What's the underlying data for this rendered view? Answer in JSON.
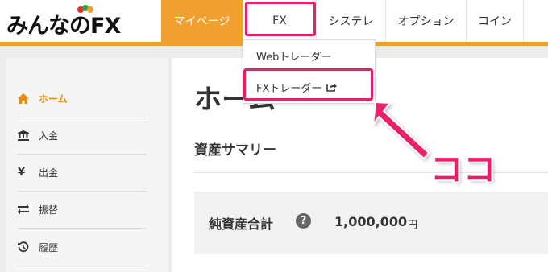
{
  "logo": {
    "text": "みんなのFX"
  },
  "nav": {
    "tabs": [
      {
        "label": "マイページ",
        "active": true
      },
      {
        "label": "FX",
        "active": false
      },
      {
        "label": "システレ",
        "active": false
      },
      {
        "label": "オプション",
        "active": false
      },
      {
        "label": "コイン",
        "active": false
      }
    ]
  },
  "dropdown": {
    "items": [
      {
        "label": "Webトレーダー"
      },
      {
        "label": "FXトレーダー",
        "icon": "external-link-icon"
      }
    ]
  },
  "sidebar": {
    "items": [
      {
        "label": "ホーム",
        "icon": "home-icon",
        "active": true
      },
      {
        "label": "入金",
        "icon": "bank-icon"
      },
      {
        "label": "出金",
        "icon": "yen-icon"
      },
      {
        "label": "振替",
        "icon": "transfer-icon"
      },
      {
        "label": "履歴",
        "icon": "history-icon"
      }
    ]
  },
  "main": {
    "title": "ホーム",
    "section_title": "資産サマリー",
    "net_assets_label": "純資産合計",
    "net_assets_value": "1,000,000",
    "net_assets_unit": "円"
  },
  "annotation": {
    "callout": "ココ"
  },
  "colors": {
    "accent": "#f0a030",
    "highlight": "#e8206a",
    "active_sidebar": "#e88a10"
  }
}
